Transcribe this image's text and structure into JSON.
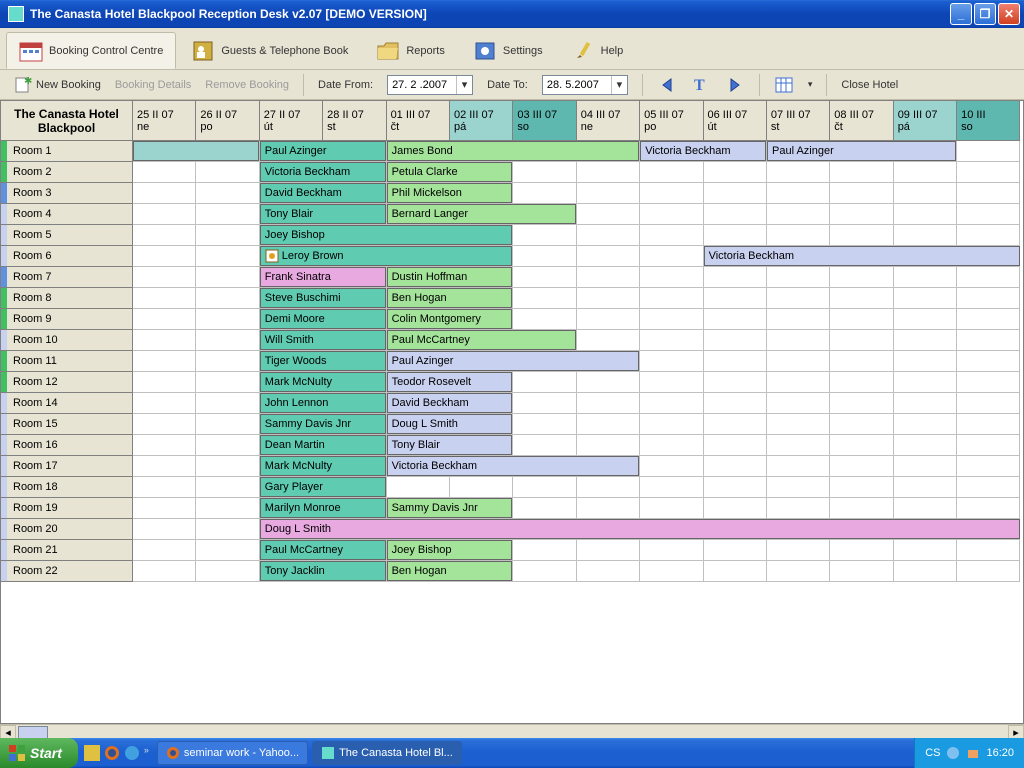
{
  "window": {
    "title": "The Canasta Hotel Blackpool Reception Desk v2.07 [DEMO VERSION]"
  },
  "tabs": {
    "booking": "Booking Control Centre",
    "guests": "Guests & Telephone Book",
    "reports": "Reports",
    "settings": "Settings",
    "help": "Help"
  },
  "actions": {
    "new_booking": "New Booking",
    "booking_details": "Booking Details",
    "remove_booking": "Remove Booking",
    "date_from_label": "Date From:",
    "date_from": "27. 2 .2007",
    "date_to_label": "Date To:",
    "date_to": "28. 5.2007",
    "close_hotel": "Close Hotel"
  },
  "hotel_name": "The Canasta Hotel Blackpool",
  "columns": [
    {
      "d1": "25 II 07",
      "d2": "ne",
      "kind": ""
    },
    {
      "d1": "26 II 07",
      "d2": "po",
      "kind": ""
    },
    {
      "d1": "27 II 07",
      "d2": "út",
      "kind": ""
    },
    {
      "d1": "28 II 07",
      "d2": "st",
      "kind": ""
    },
    {
      "d1": "01 III 07",
      "d2": "čt",
      "kind": ""
    },
    {
      "d1": "02 III 07",
      "d2": "pá",
      "kind": "ne"
    },
    {
      "d1": "03 III 07",
      "d2": "so",
      "kind": "so"
    },
    {
      "d1": "04 III 07",
      "d2": "ne",
      "kind": ""
    },
    {
      "d1": "05 III 07",
      "d2": "po",
      "kind": ""
    },
    {
      "d1": "06 III 07",
      "d2": "út",
      "kind": ""
    },
    {
      "d1": "07 III 07",
      "d2": "st",
      "kind": ""
    },
    {
      "d1": "08 III 07",
      "d2": "čt",
      "kind": ""
    },
    {
      "d1": "09 III 07",
      "d2": "pá",
      "kind": "ne"
    },
    {
      "d1": "10 III",
      "d2": "so",
      "kind": "so"
    }
  ],
  "rooms": [
    {
      "name": "Room 1",
      "color": "#40c060"
    },
    {
      "name": "Room 2",
      "color": "#40c060"
    },
    {
      "name": "Room 3",
      "color": "#6090e0"
    },
    {
      "name": "Room 4",
      "color": "#c9d1f0"
    },
    {
      "name": "Room 5",
      "color": "#c9d1f0"
    },
    {
      "name": "Room 6",
      "color": "#c9d1f0"
    },
    {
      "name": "Room 7",
      "color": "#6090e0"
    },
    {
      "name": "Room 8",
      "color": "#40c060"
    },
    {
      "name": "Room 9",
      "color": "#40c060"
    },
    {
      "name": "Room 10",
      "color": "#c9d1f0"
    },
    {
      "name": "Room 11",
      "color": "#40c060"
    },
    {
      "name": "Room 12",
      "color": "#40c060"
    },
    {
      "name": "Room 14",
      "color": "#c9d1f0"
    },
    {
      "name": "Room 15",
      "color": "#c9d1f0"
    },
    {
      "name": "Room 16",
      "color": "#c9d1f0"
    },
    {
      "name": "Room 17",
      "color": "#c9d1f0"
    },
    {
      "name": "Room 18",
      "color": "#c9d1f0"
    },
    {
      "name": "Room 19",
      "color": "#c9d1f0"
    },
    {
      "name": "Room 20",
      "color": "#c9d1f0"
    },
    {
      "name": "Room 21",
      "color": "#c9d1f0"
    },
    {
      "name": "Room 22",
      "color": "#c9d1f0"
    }
  ],
  "bookings": [
    {
      "room": 0,
      "start": 0,
      "span": 2,
      "label": "",
      "color": "c-ltteal"
    },
    {
      "room": 0,
      "start": 2,
      "span": 2,
      "label": "Paul Azinger",
      "color": "c-teal1"
    },
    {
      "room": 0,
      "start": 4,
      "span": 4,
      "label": "James Bond",
      "color": "c-green"
    },
    {
      "room": 0,
      "start": 8,
      "span": 2,
      "label": "Victoria Beckham",
      "color": "c-lav"
    },
    {
      "room": 0,
      "start": 10,
      "span": 3,
      "label": "Paul Azinger",
      "color": "c-lav"
    },
    {
      "room": 1,
      "start": 2,
      "span": 2,
      "label": "Victoria Beckham",
      "color": "c-teal1"
    },
    {
      "room": 1,
      "start": 4,
      "span": 2,
      "label": "Petula Clarke",
      "color": "c-green"
    },
    {
      "room": 2,
      "start": 2,
      "span": 2,
      "label": "David Beckham",
      "color": "c-teal1"
    },
    {
      "room": 2,
      "start": 4,
      "span": 2,
      "label": "Phil Mickelson",
      "color": "c-green"
    },
    {
      "room": 3,
      "start": 2,
      "span": 2,
      "label": "Tony Blair",
      "color": "c-teal1"
    },
    {
      "room": 3,
      "start": 4,
      "span": 3,
      "label": "Bernard Langer",
      "color": "c-green"
    },
    {
      "room": 4,
      "start": 2,
      "span": 4,
      "label": "Joey Bishop",
      "color": "c-teal1"
    },
    {
      "room": 5,
      "start": 2,
      "span": 4,
      "label": "Leroy Brown",
      "color": "c-teal1",
      "icon": true
    },
    {
      "room": 5,
      "start": 9,
      "span": 5,
      "label": "Victoria Beckham",
      "color": "c-lav"
    },
    {
      "room": 6,
      "start": 2,
      "span": 2,
      "label": "Frank Sinatra",
      "color": "c-pink"
    },
    {
      "room": 6,
      "start": 4,
      "span": 2,
      "label": "Dustin Hoffman",
      "color": "c-green"
    },
    {
      "room": 7,
      "start": 2,
      "span": 2,
      "label": "Steve Buschimi",
      "color": "c-teal1"
    },
    {
      "room": 7,
      "start": 4,
      "span": 2,
      "label": "Ben  Hogan",
      "color": "c-green"
    },
    {
      "room": 8,
      "start": 2,
      "span": 2,
      "label": "Demi Moore",
      "color": "c-teal1"
    },
    {
      "room": 8,
      "start": 4,
      "span": 2,
      "label": "Colin  Montgomery",
      "color": "c-green"
    },
    {
      "room": 9,
      "start": 2,
      "span": 2,
      "label": "Will Smith",
      "color": "c-teal1"
    },
    {
      "room": 9,
      "start": 4,
      "span": 3,
      "label": "Paul McCartney",
      "color": "c-green"
    },
    {
      "room": 10,
      "start": 2,
      "span": 2,
      "label": "Tiger Woods",
      "color": "c-teal1"
    },
    {
      "room": 10,
      "start": 4,
      "span": 4,
      "label": "Paul Azinger",
      "color": "c-lav"
    },
    {
      "room": 11,
      "start": 2,
      "span": 2,
      "label": "Mark McNulty",
      "color": "c-teal1"
    },
    {
      "room": 11,
      "start": 4,
      "span": 2,
      "label": "Teodor Rosevelt",
      "color": "c-lav"
    },
    {
      "room": 12,
      "start": 2,
      "span": 2,
      "label": "John Lennon",
      "color": "c-teal1"
    },
    {
      "room": 12,
      "start": 4,
      "span": 2,
      "label": "David Beckham",
      "color": "c-lav"
    },
    {
      "room": 13,
      "start": 2,
      "span": 2,
      "label": "Sammy Davis Jnr",
      "color": "c-teal1"
    },
    {
      "room": 13,
      "start": 4,
      "span": 2,
      "label": "Doug L Smith",
      "color": "c-lav"
    },
    {
      "room": 14,
      "start": 2,
      "span": 2,
      "label": "Dean Martin",
      "color": "c-teal1"
    },
    {
      "room": 14,
      "start": 4,
      "span": 2,
      "label": "Tony Blair",
      "color": "c-lav"
    },
    {
      "room": 15,
      "start": 2,
      "span": 2,
      "label": "Mark McNulty",
      "color": "c-teal1"
    },
    {
      "room": 15,
      "start": 4,
      "span": 4,
      "label": "Victoria Beckham",
      "color": "c-lav"
    },
    {
      "room": 16,
      "start": 2,
      "span": 2,
      "label": "Gary Player",
      "color": "c-teal1"
    },
    {
      "room": 17,
      "start": 2,
      "span": 2,
      "label": "Marilyn Monroe",
      "color": "c-teal1"
    },
    {
      "room": 17,
      "start": 4,
      "span": 2,
      "label": "Sammy Davis Jnr",
      "color": "c-green"
    },
    {
      "room": 18,
      "start": 2,
      "span": 12,
      "label": "Doug L Smith",
      "color": "c-pink"
    },
    {
      "room": 19,
      "start": 2,
      "span": 2,
      "label": "Paul McCartney",
      "color": "c-teal1"
    },
    {
      "room": 19,
      "start": 4,
      "span": 2,
      "label": "Joey Bishop",
      "color": "c-green"
    },
    {
      "room": 20,
      "start": 2,
      "span": 2,
      "label": "Tony Jacklin",
      "color": "c-teal1"
    },
    {
      "room": 20,
      "start": 4,
      "span": 2,
      "label": "Ben  Hogan",
      "color": "c-green"
    }
  ],
  "taskbar": {
    "start": "Start",
    "item1": "seminar work - Yahoo...",
    "item2": "The Canasta Hotel Bl...",
    "lang": "CS",
    "clock": "16:20"
  }
}
